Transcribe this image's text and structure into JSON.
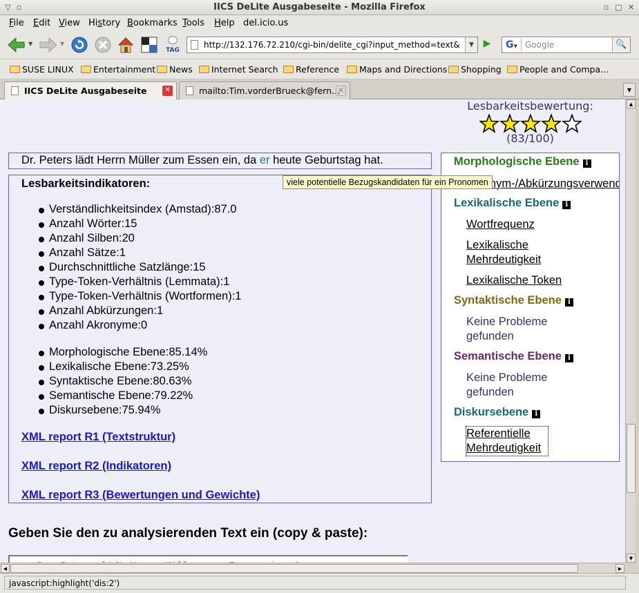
{
  "window": {
    "title": "IICS DeLite Ausgabeseite - Mozilla Firefox"
  },
  "menu": [
    {
      "label": "File",
      "key": "F",
      "rest": "ile"
    },
    {
      "label": "Edit",
      "key": "E",
      "rest": "dit"
    },
    {
      "label": "View",
      "key": "V",
      "rest": "iew"
    },
    {
      "label": "History",
      "key": "s",
      "pre": "Hi",
      "rest": "tory"
    },
    {
      "label": "Bookmarks",
      "key": "B",
      "rest": "ookmarks"
    },
    {
      "label": "Tools",
      "key": "T",
      "rest": "ools"
    },
    {
      "label": "Help",
      "key": "H",
      "rest": "elp"
    },
    {
      "label": "del.icio.us"
    }
  ],
  "toolbar": {
    "url": "http://132.176.72.210/cgi-bin/delite_cgi?input_method=text&",
    "search_placeholder": "Google",
    "search_engine": "G",
    "tag_label": "TAG"
  },
  "bookmarks": [
    "SUSE LINUX",
    "Entertainment",
    "News",
    "Internet Search",
    "Reference",
    "Maps and Directions",
    "Shopping",
    "People and Compa..."
  ],
  "tabs": [
    {
      "label": "IICS DeLite Ausgabeseite",
      "active": true
    },
    {
      "label": "mailto:Tim.vorderBrueck@fern...",
      "active": false
    }
  ],
  "page": {
    "rating_label": "Lesbarkeitsbewertung:",
    "stars_filled": 4,
    "stars_total": 5,
    "score": "(83/100)",
    "sentence": {
      "before": "Dr. Peters lädt Herrn Müller zum Essen ein, da ",
      "highlight": "er",
      "after": " heute Geburtstag hat."
    },
    "tooltip": "viele potentielle Bezugskandidaten für ein Pronomen",
    "indicators_title": "Lesbarkeitsindikatoren:",
    "indicators": [
      "Verständlichkeitsindex (Amstad):87.0",
      "Anzahl Wörter:15",
      "Anzahl Silben:20",
      "Anzahl Sätze:1",
      "Durchschnittliche Satzlänge:15",
      "Type-Token-Verhältnis (Lemmata):1",
      "Type-Token-Verhältnis (Wortformen):1",
      "Anzahl Abkürzungen:1",
      "Anzahl Akronyme:0"
    ],
    "levels": [
      "Morphologische Ebene:85.14%",
      "Lexikalische Ebene:73.25%",
      "Syntaktische Ebene:80.63%",
      "Semantische Ebene:79.22%",
      "Diskursebene:75.94%"
    ],
    "xml_reports": [
      "XML report R1 (Textstruktur)",
      "XML report R2 (Indikatoren)",
      "XML report R3 (Bewertungen und Gewichte)"
    ],
    "side": {
      "morph_heading": "Morphologische Ebene",
      "morph_item": "Akronym-/Abkürzungsverwendung",
      "lex_heading": "Lexikalische Ebene",
      "lex_items": [
        "Wortfrequenz",
        "Lexikalische Mehrdeutigkeit",
        "Lexikalische Token"
      ],
      "syn_heading": "Syntaktische Ebene",
      "syn_text": "Keine Probleme gefunden",
      "sem_heading": "Semantische Ebene",
      "sem_text": "Keine Probleme gefunden",
      "disc_heading": "Diskursebene",
      "disc_item": "Referentielle Mehrdeutigkeit"
    },
    "input_heading": "Geben Sie den zu analysierenden Text ein (copy & paste):"
  },
  "status": "javascript:highlight('dis:2')",
  "colors": {
    "morph": "#2a7a1a",
    "lex": "#1a6a6a",
    "syn": "#7a6a10",
    "sem": "#6a2a6a",
    "disc": "#1a6a6a",
    "link": "#1a1acc",
    "page_bg": "#eeeef8"
  }
}
